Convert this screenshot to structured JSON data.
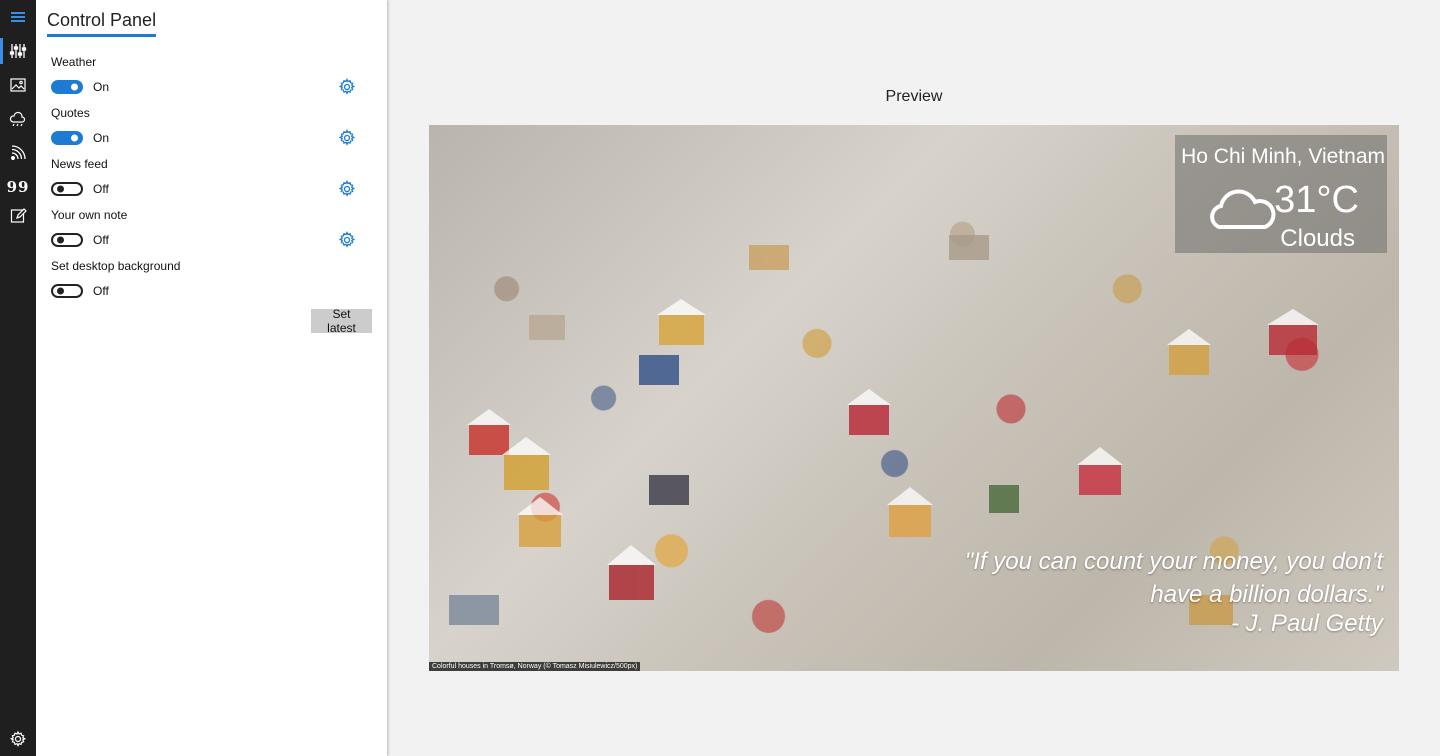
{
  "panel": {
    "title": "Control Panel"
  },
  "rail": {
    "items": [
      {
        "icon": "menu-icon"
      },
      {
        "icon": "sliders-icon",
        "active": true
      },
      {
        "icon": "image-icon"
      },
      {
        "icon": "weather-icon"
      },
      {
        "icon": "rss-icon"
      },
      {
        "icon": "quote-icon",
        "glyph": "99"
      },
      {
        "icon": "edit-note-icon"
      },
      {
        "icon": "gear-icon"
      }
    ]
  },
  "settings": [
    {
      "label": "Weather",
      "state": "On"
    },
    {
      "label": "Quotes",
      "state": "On"
    },
    {
      "label": "News feed",
      "state": "Off"
    },
    {
      "label": "Your own note",
      "state": "Off"
    },
    {
      "label": "Set desktop background",
      "state": "Off"
    }
  ],
  "set_latest_label": "Set latest",
  "preview": {
    "label": "Preview",
    "weather": {
      "city": "Ho Chi Minh, Vietnam",
      "temp": "31°C",
      "condition": "Clouds"
    },
    "quote": {
      "text": "\"If you can count your money, you don't have a billion dollars.\"",
      "author": "- J. Paul Getty"
    },
    "caption": "Colorful houses in Tromsø, Norway (© Tomasz Misiulewicz/500px)"
  },
  "colors": {
    "accent": "#1e7bd2",
    "rail": "#1f1f1f",
    "background": "#f2f2f2"
  }
}
